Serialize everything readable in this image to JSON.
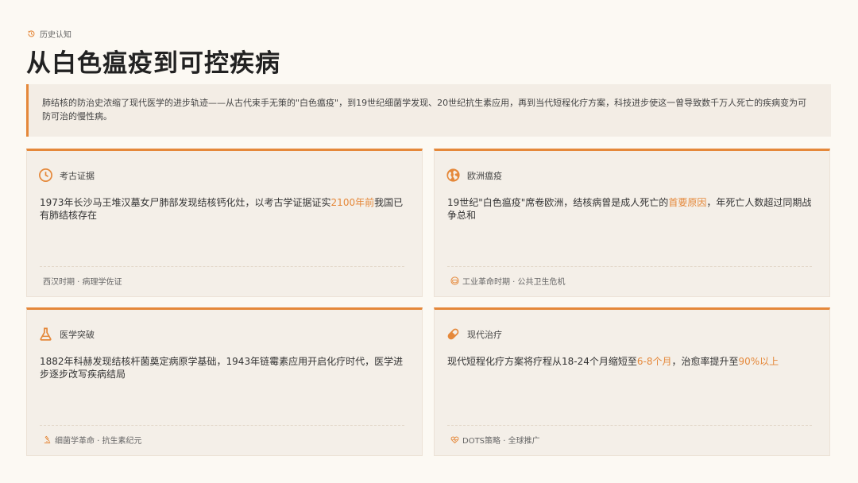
{
  "header": {
    "eyebrow": "历史认知",
    "title": "从白色瘟疫到可控疾病"
  },
  "intro": "肺结核的防治史浓缩了现代医学的进步轨迹——从古代束手无策的\"白色瘟疫\"，到19世纪细菌学发现、20世纪抗生素应用，再到当代短程化疗方案，科技进步使这一曾导致数千万人死亡的疾病变为可防可治的慢性病。",
  "cards": [
    {
      "title": "考古证据",
      "icon": "clock-icon",
      "body_before": "1973年长沙马王堆汉墓女尸肺部发现结核钙化灶，以考古学证据证实",
      "highlight": "2100年前",
      "body_after": "我国已有肺结核存在",
      "footer": "西汉时期 · 病理学佐证"
    },
    {
      "title": "欧洲瘟疫",
      "icon": "globe-icon",
      "body_before": "19世纪\"白色瘟疫\"席卷欧洲，结核病曾是成人死亡的",
      "highlight": "首要原因",
      "body_after": "，年死亡人数超过同期战争总和",
      "footer": "工业革命时期 · 公共卫生危机",
      "footer_icon": "mask-icon"
    },
    {
      "title": "医学突破",
      "icon": "flask-icon",
      "body_before": "1882年科赫发现结核杆菌奠定病原学基础，1943年链霉素应用开启化疗时代，医学进步逐步改写疾病结局",
      "footer": "细菌学革命 · 抗生素纪元",
      "footer_icon": "microscope-icon"
    },
    {
      "title": "现代治疗",
      "icon": "pill-icon",
      "body_before": "现代短程化疗方案将疗程从18-24个月缩短至",
      "highlight": "6-8个月",
      "body_mid": "，治愈率提升至",
      "highlight2": "90%以上",
      "footer": "DOTS策略 · 全球推广",
      "footer_icon": "heartbeat-icon"
    }
  ],
  "colors": {
    "accent": "#e5883a",
    "background": "#fcf9f3",
    "card": "#f4efe8"
  }
}
